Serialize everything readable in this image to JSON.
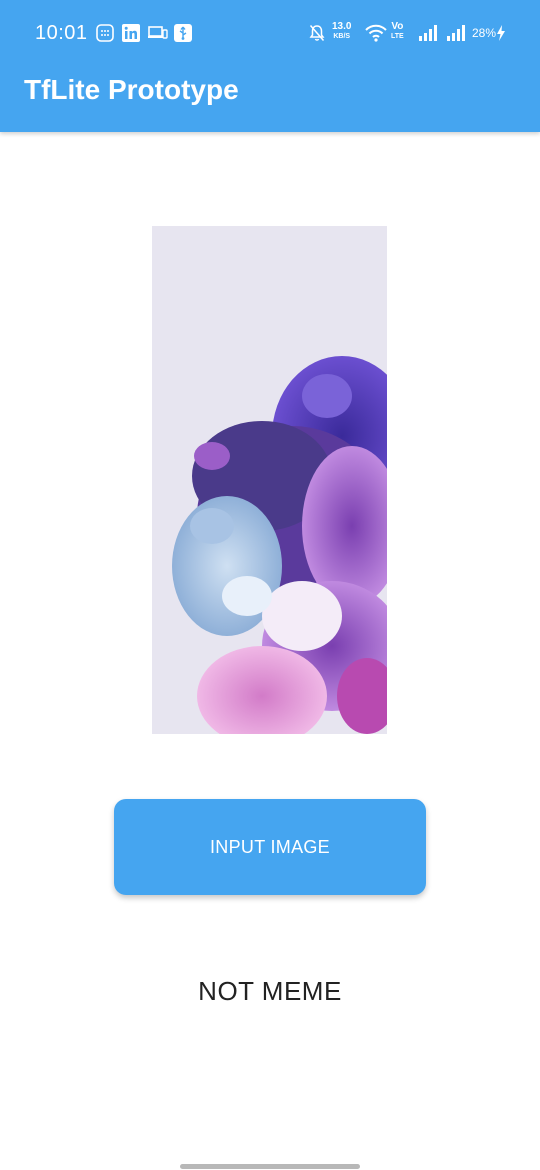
{
  "status_bar": {
    "time": "10:01",
    "net_speed_value": "13.0",
    "net_speed_unit": "KB/S",
    "network_label_top": "Vo",
    "network_label_bottom": "LTE",
    "battery_percent": "28%",
    "icons": [
      "message-icon",
      "linkedin-icon",
      "cast-icon",
      "usb-icon",
      "mute-icon",
      "wifi-icon",
      "signal-icon",
      "signal-icon",
      "charging-icon"
    ]
  },
  "app_bar": {
    "title": "TfLite Prototype",
    "color": "#45a5f0"
  },
  "main": {
    "image_alt": "purple flower wallpaper",
    "button_label": "INPUT IMAGE",
    "result_text": "NOT MEME"
  }
}
